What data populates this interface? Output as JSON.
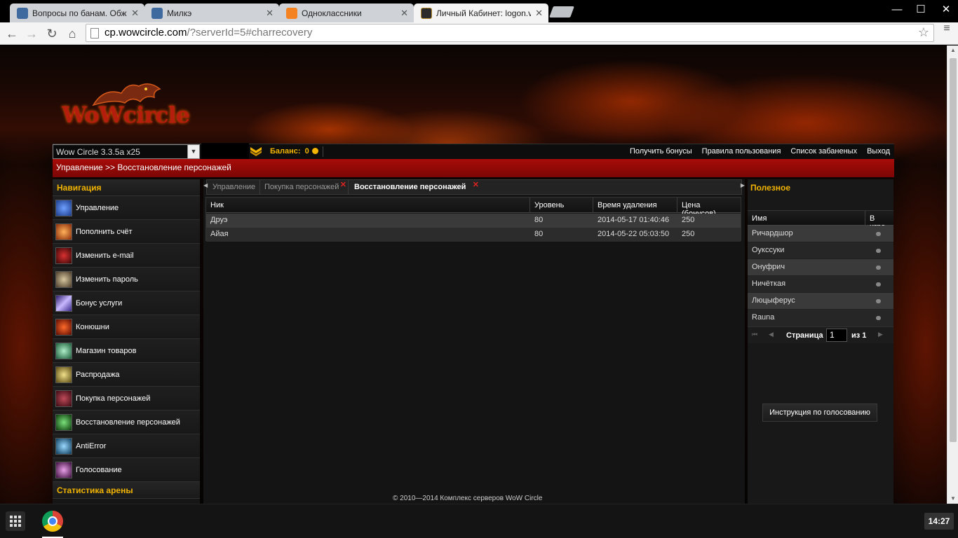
{
  "browser": {
    "tabs": [
      {
        "title": "Вопросы по банам. Обж",
        "favicon_color": "#3f6aa0"
      },
      {
        "title": "Милкэ",
        "favicon_color": "#3f6aa0"
      },
      {
        "title": "Одноклассники",
        "favicon_color": "#f58220"
      },
      {
        "title": "Личный Кабинет: logon.v",
        "favicon_color": "#2b2b2b"
      }
    ],
    "close_glyph": "✕",
    "window_buttons": {
      "minimize": "—",
      "maximize": "☐",
      "close": "✕"
    },
    "nav": {
      "back": "←",
      "forward": "→",
      "reload": "↻",
      "home": "⌂"
    },
    "url_host": "cp.wowcircle.com",
    "url_rest": "/?serverId=5#charrecovery",
    "star_icon": "☆",
    "menu_icon": "≡"
  },
  "site": {
    "logo_text": "WoWcircle",
    "server_select": "Wow Circle 3.3.5a x25",
    "balance_label": "Баланс:",
    "balance_value": "0",
    "top_links": [
      "Получить бонусы",
      "Правила пользования",
      "Список забаненых",
      "Выход"
    ],
    "breadcrumb": "Управление >> Восстановление персонажей",
    "nav_heading": "Навигация",
    "nav_items": [
      {
        "label": "Управление",
        "color": "#2a5db0"
      },
      {
        "label": "Пополнить счёт",
        "color": "#c4520e"
      },
      {
        "label": "Изменить e-mail",
        "color": "#8a1010"
      },
      {
        "label": "Изменить пароль",
        "color": "#7a6a50"
      },
      {
        "label": "Бонус услуги",
        "color": "#5a3aa8"
      },
      {
        "label": "Конюшни",
        "color": "#b02810"
      },
      {
        "label": "Магазин товаров",
        "color": "#2a8a5a"
      },
      {
        "label": "Распродажа",
        "color": "#9a8a30"
      },
      {
        "label": "Покупка персонажей",
        "color": "#7a1a2a"
      },
      {
        "label": "Восстановление персонажей",
        "color": "#2a7a2a"
      },
      {
        "label": "AntiError",
        "color": "#1a6a9a"
      },
      {
        "label": "Голосование",
        "color": "#8a2a8a"
      }
    ],
    "arena_heading": "Статистика арены",
    "content_tabs": [
      {
        "label": "Управление",
        "closable": false
      },
      {
        "label": "Покупка персонажей",
        "closable": true
      },
      {
        "label": "Восстановление персонажей",
        "closable": true
      }
    ],
    "tab_close_glyph": "✕",
    "table": {
      "columns": [
        "Ник",
        "Уровень",
        "Время удаления",
        "Цена (бонусов)"
      ],
      "rows": [
        [
          "Друэ",
          "80",
          "2014-05-17 01:40:46",
          "250"
        ],
        [
          "Айая",
          "80",
          "2014-05-22 05:03:50",
          "250"
        ]
      ]
    },
    "useful_heading": "Полезное",
    "players_table": {
      "columns": [
        "Имя",
        "В игре"
      ],
      "rows": [
        "Ричардшор",
        "Оукссуки",
        "Онуфрич",
        "Ничёткая",
        "Люцыферус",
        "Rauna"
      ]
    },
    "pager": {
      "label": "Страница",
      "page": "1",
      "of": "из 1",
      "first": "⏮",
      "prev": "◀",
      "next": "▶",
      "last": "⏭"
    },
    "vote_button": "Инструкция по голосованию",
    "footer": "© 2010—2014 Комплекс серверов WoW Circle"
  },
  "taskbar": {
    "clock": "14:27"
  },
  "colors": {
    "accent_gold": "#f2b400",
    "breadcrumb_red": "#a70c08"
  }
}
